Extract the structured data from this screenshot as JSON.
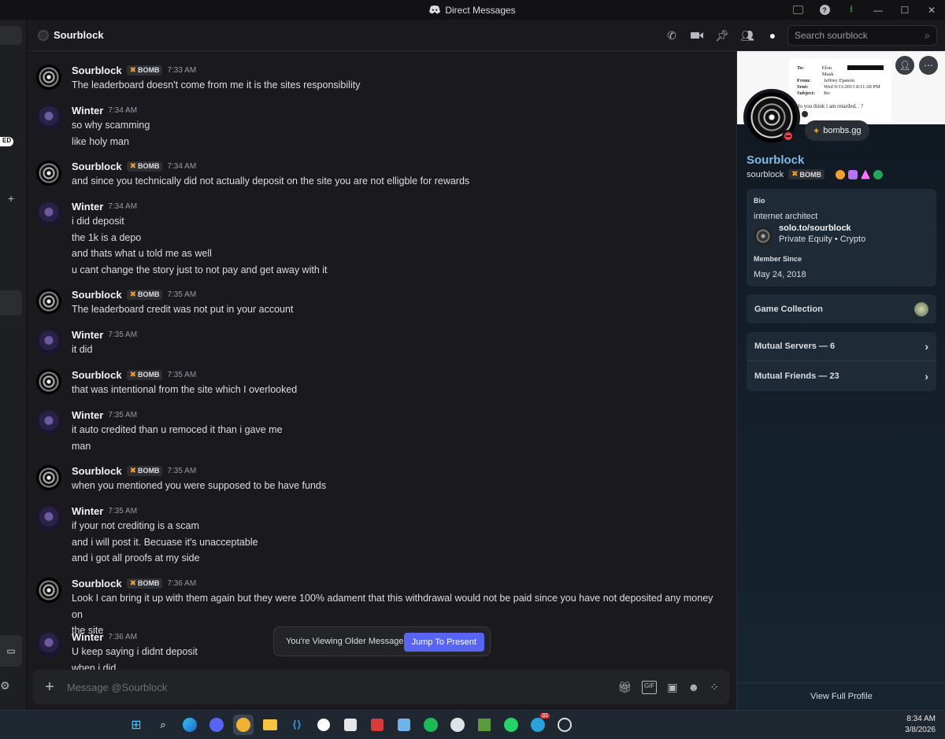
{
  "window": {
    "title": "Direct Messages"
  },
  "header": {
    "dm_name": "Sourblock",
    "search_placeholder": "Search sourblock"
  },
  "messages": [
    {
      "author": "Sourblock",
      "tag": "BOMB",
      "time": "7:33 AM",
      "avatar": "sour",
      "lines": [
        "The leaderboard doesn't come from me it is the sites responsibility"
      ]
    },
    {
      "author": "Winter",
      "tag": "",
      "time": "7:34 AM",
      "avatar": "winter",
      "lines": [
        "so why scamming",
        "like holy man"
      ]
    },
    {
      "author": "Sourblock",
      "tag": "BOMB",
      "time": "7:34 AM",
      "avatar": "sour",
      "lines": [
        "and since you technically did not actually deposit on the site you are not elligble for rewards"
      ]
    },
    {
      "author": "Winter",
      "tag": "",
      "time": "7:34 AM",
      "avatar": "winter",
      "lines": [
        "i did deposit",
        "the 1k is a depo",
        "and thats what u told me as well",
        "u cant change the story just to not pay and get away with it"
      ]
    },
    {
      "author": "Sourblock",
      "tag": "BOMB",
      "time": "7:35 AM",
      "avatar": "sour",
      "lines": [
        "The leaderboard credit was not put in your account"
      ]
    },
    {
      "author": "Winter",
      "tag": "",
      "time": "7:35 AM",
      "avatar": "winter",
      "lines": [
        "it did"
      ]
    },
    {
      "author": "Sourblock",
      "tag": "BOMB",
      "time": "7:35 AM",
      "avatar": "sour",
      "lines": [
        "that was intentional from the site which I overlooked"
      ]
    },
    {
      "author": "Winter",
      "tag": "",
      "time": "7:35 AM",
      "avatar": "winter",
      "lines": [
        "it auto credited than u remoced it than i gave me",
        "man"
      ]
    },
    {
      "author": "Sourblock",
      "tag": "BOMB",
      "time": "7:35 AM",
      "avatar": "sour",
      "lines": [
        "when you mentioned you were supposed to be have funds"
      ]
    },
    {
      "author": "Winter",
      "tag": "",
      "time": "7:35 AM",
      "avatar": "winter",
      "lines": [
        "if your not crediting is a scam",
        "and i will post it. Becuase it's unacceptable",
        "and i got all proofs at my side"
      ]
    },
    {
      "author": "Sourblock",
      "tag": "BOMB",
      "time": "7:36 AM",
      "avatar": "sour",
      "lines": [
        "Look I can bring it up with them again but they were 100% adament that this withdrawal would not be paid since you have not deposited any money on",
        "the site"
      ]
    },
    {
      "author": "Winter",
      "tag": "",
      "time": "7:36 AM",
      "avatar": "winter",
      "lines": [
        "U keep saying i didnt deposit",
        "when i did"
      ]
    }
  ],
  "older_banner": {
    "text": "You're Viewing Older Messages",
    "button": "Jump To Present"
  },
  "composer": {
    "placeholder": "Message @Sourblock"
  },
  "profile": {
    "display_name": "Sourblock",
    "username": "sourblock",
    "tag": "BOMB",
    "status": "bombs.gg",
    "banner_email": {
      "to_label": "To:",
      "to_value": "Elon Musk",
      "from_label": "From:",
      "from_value": "Jeffrey Epstein",
      "sent_label": "Sent:",
      "sent_value": "Wed 9/11/2013 8:11:28 PM",
      "subject_label": "Subject:",
      "subject_value": "Re:",
      "body": "do you think i am retarded,  .  ?"
    },
    "bio_label": "Bio",
    "bio_text": "internet architect",
    "link_title": "solo.to/sourblock",
    "link_sub": "Private Equity • Crypto",
    "member_since_label": "Member Since",
    "member_since": "May 24, 2018",
    "game_collection": "Game Collection",
    "mutual_servers": "Mutual Servers — 6",
    "mutual_friends": "Mutual Friends — 23",
    "view_full": "View Full Profile"
  },
  "left_strip": {
    "badge": "ED"
  },
  "taskbar": {
    "time": "8:34 AM",
    "date": "3/8/2026",
    "notif_count": "31"
  },
  "colors": {
    "accent": "#5865f2",
    "name_blue": "#7fb9e5",
    "dnd": "#f23f43"
  }
}
